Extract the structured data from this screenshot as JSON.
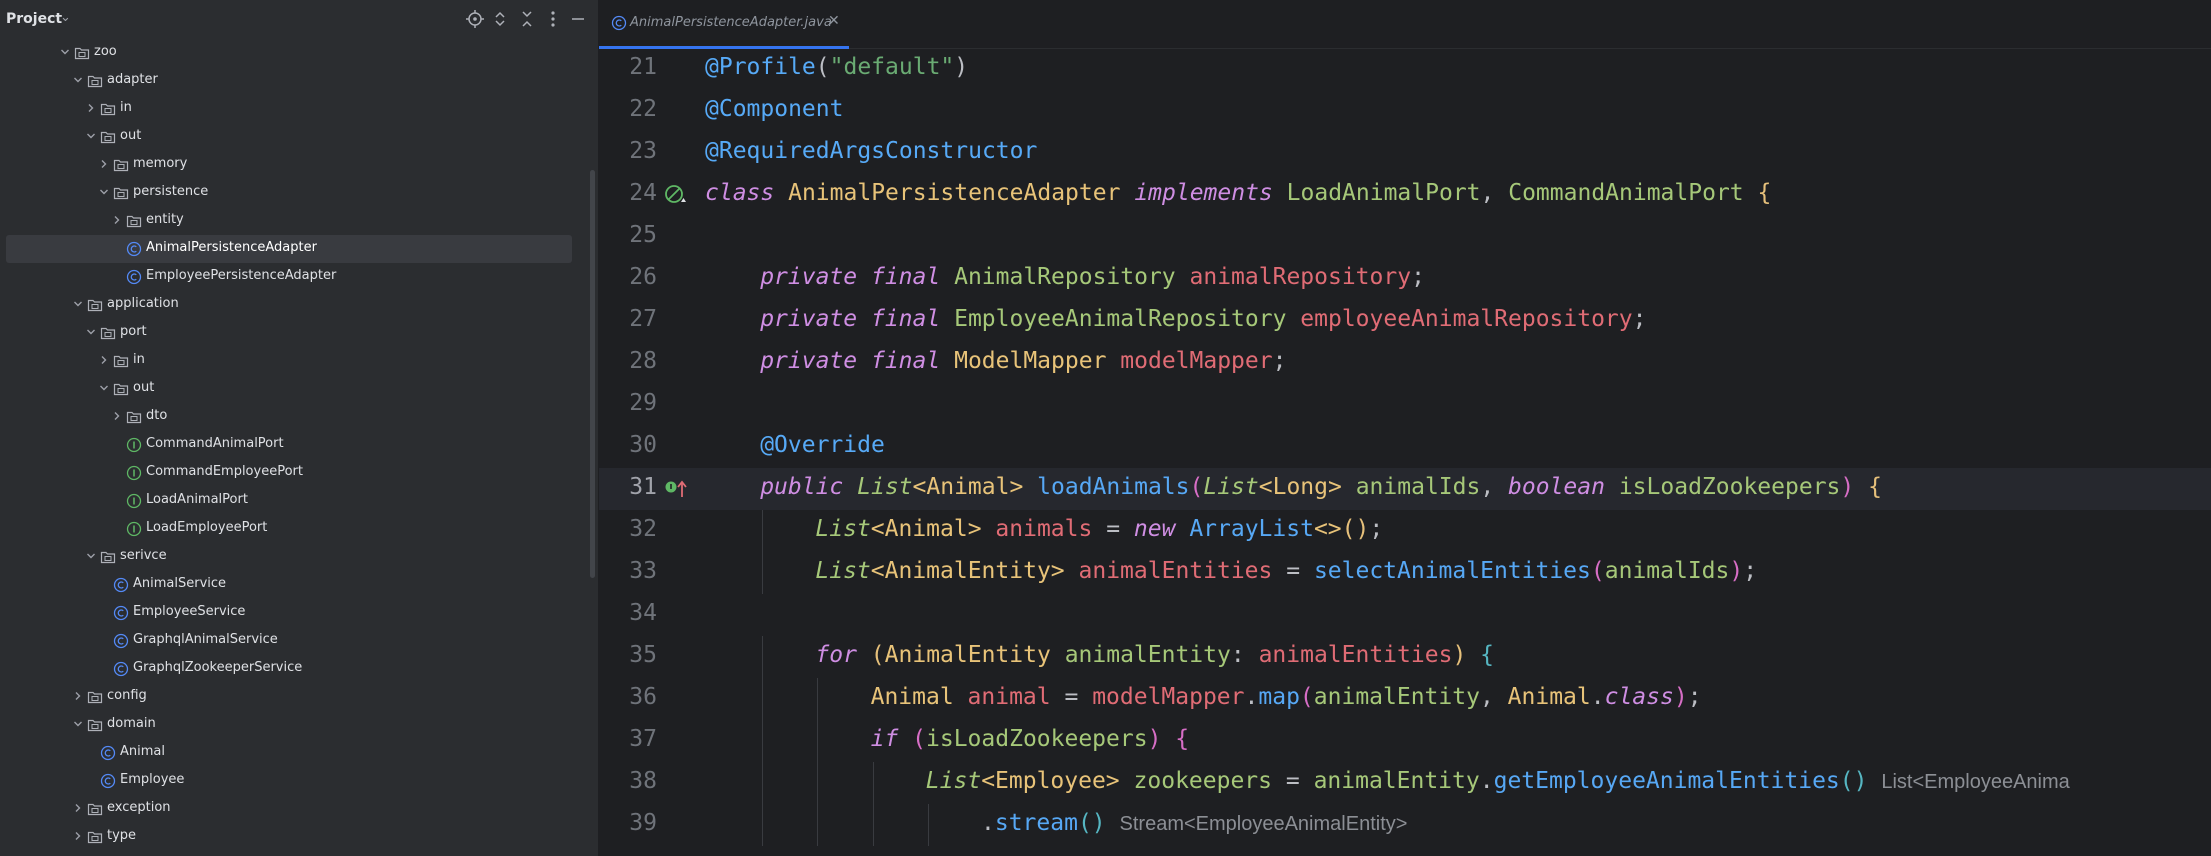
{
  "project_panel": {
    "title": "Project",
    "icons": [
      "locate-icon",
      "expand-icon",
      "collapse-icon",
      "more-options-icon",
      "hide-icon"
    ],
    "tree": [
      {
        "label": "zoo",
        "depth": 0,
        "type": "folder",
        "expanded": true
      },
      {
        "label": "adapter",
        "depth": 1,
        "type": "folder",
        "expanded": true
      },
      {
        "label": "in",
        "depth": 2,
        "type": "folder",
        "expanded": false
      },
      {
        "label": "out",
        "depth": 2,
        "type": "folder",
        "expanded": true
      },
      {
        "label": "memory",
        "depth": 3,
        "type": "folder",
        "expanded": false
      },
      {
        "label": "persistence",
        "depth": 3,
        "type": "folder",
        "expanded": true
      },
      {
        "label": "entity",
        "depth": 4,
        "type": "folder",
        "expanded": false
      },
      {
        "label": "AnimalPersistenceAdapter",
        "depth": 4,
        "type": "class",
        "selected": true
      },
      {
        "label": "EmployeePersistenceAdapter",
        "depth": 4,
        "type": "class"
      },
      {
        "label": "application",
        "depth": 1,
        "type": "folder",
        "expanded": true
      },
      {
        "label": "port",
        "depth": 2,
        "type": "folder",
        "expanded": true
      },
      {
        "label": "in",
        "depth": 3,
        "type": "folder",
        "expanded": false
      },
      {
        "label": "out",
        "depth": 3,
        "type": "folder",
        "expanded": true
      },
      {
        "label": "dto",
        "depth": 4,
        "type": "folder",
        "expanded": false
      },
      {
        "label": "CommandAnimalPort",
        "depth": 4,
        "type": "interface"
      },
      {
        "label": "CommandEmployeePort",
        "depth": 4,
        "type": "interface"
      },
      {
        "label": "LoadAnimalPort",
        "depth": 4,
        "type": "interface"
      },
      {
        "label": "LoadEmployeePort",
        "depth": 4,
        "type": "interface"
      },
      {
        "label": "serivce",
        "depth": 2,
        "type": "folder",
        "expanded": true
      },
      {
        "label": "AnimalService",
        "depth": 3,
        "type": "class"
      },
      {
        "label": "EmployeeService",
        "depth": 3,
        "type": "class"
      },
      {
        "label": "GraphqlAnimalService",
        "depth": 3,
        "type": "class"
      },
      {
        "label": "GraphqlZookeeperService",
        "depth": 3,
        "type": "class"
      },
      {
        "label": "config",
        "depth": 1,
        "type": "folder",
        "expanded": false
      },
      {
        "label": "domain",
        "depth": 1,
        "type": "folder",
        "expanded": true
      },
      {
        "label": "Animal",
        "depth": 2,
        "type": "class"
      },
      {
        "label": "Employee",
        "depth": 2,
        "type": "class"
      },
      {
        "label": "exception",
        "depth": 1,
        "type": "folder",
        "expanded": false
      },
      {
        "label": "type",
        "depth": 1,
        "type": "folder",
        "expanded": false
      }
    ]
  },
  "editor": {
    "tab": {
      "label": "AnimalPersistenceAdapter.java",
      "icon": "class-icon",
      "close_icon": "close-icon"
    },
    "current_line": 31,
    "lines": [
      {
        "num": "21",
        "tokens": [
          [
            "an",
            "@Profile"
          ],
          [
            "plain",
            "("
          ],
          [
            "str",
            "\"default\""
          ],
          [
            "plain",
            ")"
          ]
        ]
      },
      {
        "num": "22",
        "tokens": [
          [
            "an",
            "@Component"
          ]
        ]
      },
      {
        "num": "23",
        "tokens": [
          [
            "an",
            "@RequiredArgsConstructor"
          ]
        ]
      },
      {
        "num": "24",
        "gutter": "bean-icon",
        "tokens": [
          [
            "kw",
            "class"
          ],
          [
            "plain",
            " "
          ],
          [
            "ty",
            "AnimalPersistenceAdapter"
          ],
          [
            "plain",
            " "
          ],
          [
            "kw",
            "implements"
          ],
          [
            "plain",
            " "
          ],
          [
            "par",
            "LoadAnimalPort"
          ],
          [
            "plain",
            ", "
          ],
          [
            "par",
            "CommandAnimalPort"
          ],
          [
            "plain",
            " "
          ],
          [
            "br1",
            "{"
          ]
        ]
      },
      {
        "num": "25",
        "tokens": []
      },
      {
        "num": "26",
        "indent": 1,
        "tokens": [
          [
            "kw",
            "private"
          ],
          [
            "plain",
            " "
          ],
          [
            "kw",
            "final"
          ],
          [
            "plain",
            " "
          ],
          [
            "par",
            "AnimalRepository"
          ],
          [
            "plain",
            " "
          ],
          [
            "fldr",
            "animalRepository"
          ],
          [
            "plain",
            ";"
          ]
        ]
      },
      {
        "num": "27",
        "indent": 1,
        "tokens": [
          [
            "kw",
            "private"
          ],
          [
            "plain",
            " "
          ],
          [
            "kw",
            "final"
          ],
          [
            "plain",
            " "
          ],
          [
            "par",
            "EmployeeAnimalRepository"
          ],
          [
            "plain",
            " "
          ],
          [
            "fldr",
            "employeeAnimalRepository"
          ],
          [
            "plain",
            ";"
          ]
        ]
      },
      {
        "num": "28",
        "indent": 1,
        "tokens": [
          [
            "kw",
            "private"
          ],
          [
            "plain",
            " "
          ],
          [
            "kw",
            "final"
          ],
          [
            "plain",
            " "
          ],
          [
            "ty",
            "ModelMapper"
          ],
          [
            "plain",
            " "
          ],
          [
            "fldr",
            "modelMapper"
          ],
          [
            "plain",
            ";"
          ]
        ]
      },
      {
        "num": "29",
        "tokens": []
      },
      {
        "num": "30",
        "indent": 1,
        "tokens": [
          [
            "an",
            "@Override"
          ]
        ]
      },
      {
        "num": "31",
        "indent": 1,
        "gutter": "implements-icon",
        "tokens": [
          [
            "kw",
            "public"
          ],
          [
            "plain",
            " "
          ],
          [
            "ity",
            "List"
          ],
          [
            "ty",
            "<Animal>"
          ],
          [
            "plain",
            " "
          ],
          [
            "fn",
            "loadAnimals"
          ],
          [
            "br2",
            "("
          ],
          [
            "ity",
            "List"
          ],
          [
            "ty",
            "<Long>"
          ],
          [
            "plain",
            " "
          ],
          [
            "par",
            "animalIds"
          ],
          [
            "plain",
            ", "
          ],
          [
            "kw",
            "boolean"
          ],
          [
            "plain",
            " "
          ],
          [
            "par",
            "isLoadZookeepers"
          ],
          [
            "br2",
            ")"
          ],
          [
            "plain",
            " "
          ],
          [
            "br1",
            "{"
          ]
        ]
      },
      {
        "num": "32",
        "indent": 2,
        "tokens": [
          [
            "ity",
            "List"
          ],
          [
            "ty",
            "<Animal>"
          ],
          [
            "plain",
            " "
          ],
          [
            "fldr",
            "animals"
          ],
          [
            "plain",
            " = "
          ],
          [
            "kw",
            "new"
          ],
          [
            "plain",
            " "
          ],
          [
            "fn",
            "ArrayList"
          ],
          [
            "ty",
            "<>"
          ],
          [
            "br1",
            "()"
          ],
          [
            "plain",
            ";"
          ]
        ]
      },
      {
        "num": "33",
        "indent": 2,
        "tokens": [
          [
            "ity",
            "List"
          ],
          [
            "ty",
            "<AnimalEntity>"
          ],
          [
            "plain",
            " "
          ],
          [
            "fldr",
            "animalEntities"
          ],
          [
            "plain",
            " = "
          ],
          [
            "fn",
            "selectAnimalEntities"
          ],
          [
            "br2",
            "("
          ],
          [
            "par",
            "animalIds"
          ],
          [
            "br2",
            ")"
          ],
          [
            "plain",
            ";"
          ]
        ]
      },
      {
        "num": "34",
        "tokens": []
      },
      {
        "num": "35",
        "indent": 2,
        "tokens": [
          [
            "kw",
            "for"
          ],
          [
            "plain",
            " "
          ],
          [
            "br1",
            "("
          ],
          [
            "ty",
            "AnimalEntity"
          ],
          [
            "plain",
            " "
          ],
          [
            "par",
            "animalEntity"
          ],
          [
            "plain",
            ": "
          ],
          [
            "fldr",
            "animalEntities"
          ],
          [
            "br1",
            ")"
          ],
          [
            "plain",
            " "
          ],
          [
            "br3",
            "{"
          ]
        ]
      },
      {
        "num": "36",
        "indent": 3,
        "tokens": [
          [
            "ty",
            "Animal"
          ],
          [
            "plain",
            " "
          ],
          [
            "fldr",
            "animal"
          ],
          [
            "plain",
            " = "
          ],
          [
            "fldr",
            "modelMapper"
          ],
          [
            "plain",
            "."
          ],
          [
            "fn",
            "map"
          ],
          [
            "br2",
            "("
          ],
          [
            "par",
            "animalEntity"
          ],
          [
            "plain",
            ", "
          ],
          [
            "ty",
            "Animal"
          ],
          [
            "plain",
            "."
          ],
          [
            "kw",
            "class"
          ],
          [
            "br2",
            ")"
          ],
          [
            "plain",
            ";"
          ]
        ]
      },
      {
        "num": "37",
        "indent": 3,
        "tokens": [
          [
            "kw",
            "if"
          ],
          [
            "plain",
            " "
          ],
          [
            "br2",
            "("
          ],
          [
            "par",
            "isLoadZookeepers"
          ],
          [
            "br2",
            ")"
          ],
          [
            "plain",
            " "
          ],
          [
            "br2",
            "{"
          ]
        ]
      },
      {
        "num": "38",
        "indent": 4,
        "tokens": [
          [
            "ity",
            "List"
          ],
          [
            "ty",
            "<Employee>"
          ],
          [
            "plain",
            " "
          ],
          [
            "par",
            "zookeepers"
          ],
          [
            "plain",
            " = "
          ],
          [
            "par",
            "animalEntity"
          ],
          [
            "plain",
            "."
          ],
          [
            "fn",
            "getEmployeeAnimalEntities"
          ],
          [
            "br3",
            "()"
          ],
          [
            "plain",
            " "
          ]
        ],
        "hint": "List<EmployeeAnima"
      },
      {
        "num": "39",
        "indent": 5,
        "tokens": [
          [
            "plain",
            "."
          ],
          [
            "fn",
            "stream"
          ],
          [
            "br3",
            "()"
          ],
          [
            "plain",
            " "
          ]
        ],
        "hint": "Stream<EmployeeAnimalEntity>"
      }
    ]
  },
  "colors": {
    "accent": "#3574f0",
    "panel_bg": "#2b2d30",
    "editor_bg": "#1e1f22",
    "selected_row": "#393b40"
  }
}
